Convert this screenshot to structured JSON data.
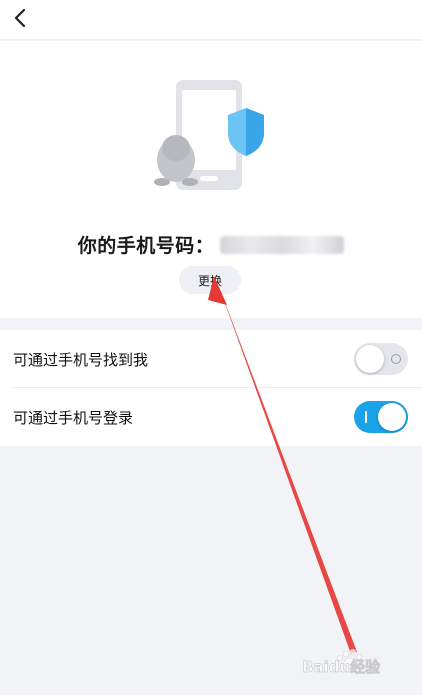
{
  "header": {
    "back_icon": "chevron-left-icon"
  },
  "hero": {
    "illustration_icons": [
      "phone-icon",
      "shield-icon",
      "penguin-icon"
    ],
    "title_prefix": "你的手机号码：",
    "change_label": "更换"
  },
  "settings": {
    "items": [
      {
        "label": "可通过手机号找到我",
        "enabled": false
      },
      {
        "label": "可通过手机号登录",
        "enabled": true
      }
    ]
  },
  "watermark": {
    "text": "Baidu经验"
  },
  "colors": {
    "accent": "#1aa3e8",
    "toggle_off": "#e5e6eb",
    "background": "#f2f3f7",
    "annotation_arrow": "#e53935"
  }
}
